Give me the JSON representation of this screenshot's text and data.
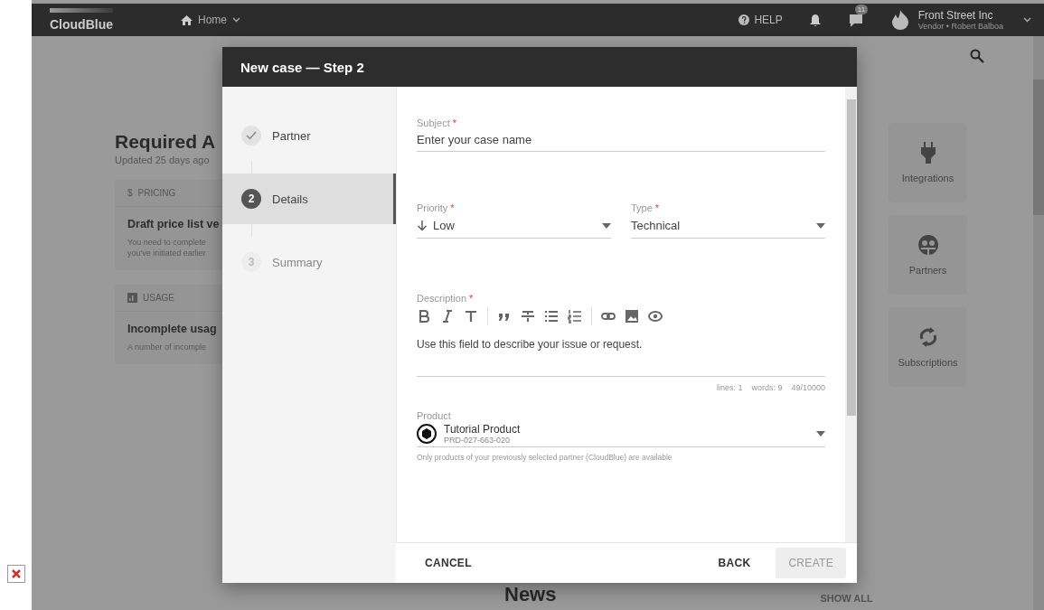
{
  "topbar": {
    "logo": "CloudBlue",
    "nav": "Home",
    "help": "HELP",
    "badge": "11",
    "account": {
      "name": "Front Street Inc",
      "role": "Vendor • Robert Balboa"
    }
  },
  "background": {
    "title": "Required A",
    "subtitle": "Updated 25 days ago",
    "cards": [
      {
        "kind": "pricing",
        "symbol": "$",
        "category": "PRICING",
        "title": "Draft price list ve",
        "lines": [
          "You need to complete",
          "you've initiated earlier"
        ]
      },
      {
        "kind": "usage",
        "category": "USAGE",
        "title": "Incomplete usag",
        "lines": [
          "A number of incomple"
        ]
      }
    ],
    "tiles": [
      {
        "kind": "plug",
        "label": "Integrations"
      },
      {
        "kind": "partners",
        "label": "Partners"
      },
      {
        "kind": "refresh",
        "label": "Subscriptions"
      }
    ],
    "news": "News",
    "show_all": "SHOW ALL"
  },
  "modal": {
    "title": "New case — Step 2",
    "steps": [
      {
        "kind": "done",
        "label": "Partner",
        "selected": false
      },
      {
        "kind": "current",
        "number": "2",
        "label": "Details",
        "selected": true
      },
      {
        "kind": "pending",
        "number": "3",
        "label": "Summary",
        "selected": false
      }
    ],
    "subject": {
      "label": "Subject",
      "required_mark": "*",
      "placeholder": "Enter your case name"
    },
    "priority": {
      "label": "Priority",
      "required_mark": "*",
      "value": "Low"
    },
    "type": {
      "label": "Type",
      "required_mark": "*",
      "value": "Technical"
    },
    "description": {
      "label": "Description",
      "required_mark": "*",
      "text": "Use this field to describe your issue or request.",
      "stats": [
        "lines: 1",
        "words: 9",
        "49/10000"
      ]
    },
    "product": {
      "label": "Product",
      "name": "Tutorial Product",
      "id": "PRD-027-663-020",
      "hint": "Only products of your previously selected partner (CloudBlue) are available"
    },
    "buttons": [
      {
        "label": "CANCEL",
        "disabled": false
      },
      {
        "label": "BACK",
        "disabled": false
      },
      {
        "label": "CREATE",
        "disabled": true
      }
    ]
  }
}
